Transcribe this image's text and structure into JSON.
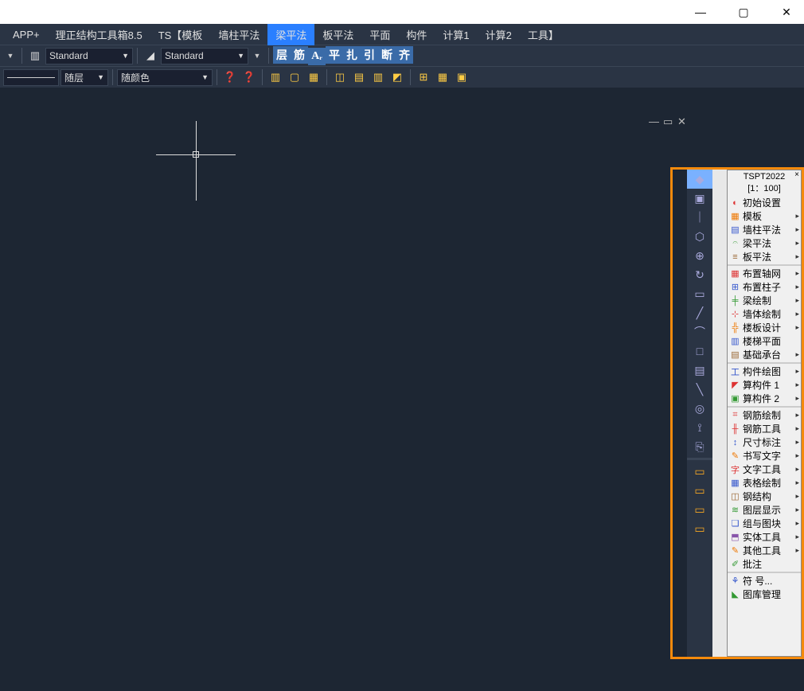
{
  "window": {
    "minimize": "—",
    "maximize": "▢",
    "close": "✕"
  },
  "menu": {
    "items": [
      "APP+",
      "理正结构工具箱8.5",
      "TS【模板",
      "墙柱平法",
      "梁平法",
      "板平法",
      "平面",
      "构件",
      "计算1",
      "计算2",
      "工具】"
    ],
    "activeIndex": 4
  },
  "toolbar1": {
    "style1": "Standard",
    "style2": "Standard",
    "rightIcons": [
      "层",
      "筋",
      "Aᵣ",
      "平",
      "扎",
      "引",
      "断",
      "齐"
    ]
  },
  "toolbar2": {
    "layer": "随层",
    "color": "随颜色"
  },
  "canvasCtrl": {
    "min": "—",
    "max": "▭",
    "close": "✕"
  },
  "rightPanel": {
    "title1": "TSPT2022",
    "title2": "[1：100]",
    "groups": [
      {
        "items": [
          {
            "label": "初始设置",
            "icon": "◐",
            "cls": "red",
            "arrow": false
          },
          {
            "label": "模板",
            "icon": "▦",
            "cls": "orange",
            "arrow": true
          },
          {
            "label": "墙柱平法",
            "icon": "▤",
            "cls": "blue",
            "arrow": true
          },
          {
            "label": "梁平法",
            "icon": "𝄐",
            "cls": "green",
            "arrow": true
          },
          {
            "label": "板平法",
            "icon": "≡",
            "cls": "brown",
            "arrow": true
          }
        ]
      },
      {
        "items": [
          {
            "label": "布置轴网",
            "icon": "▦",
            "cls": "red",
            "arrow": true
          },
          {
            "label": "布置柱子",
            "icon": "⊞",
            "cls": "blue",
            "arrow": true
          },
          {
            "label": "梁绘制",
            "icon": "╪",
            "cls": "green",
            "arrow": true
          },
          {
            "label": "墙体绘制",
            "icon": "⊹",
            "cls": "red",
            "arrow": true
          },
          {
            "label": "楼板设计",
            "icon": "╬",
            "cls": "orange",
            "arrow": true
          },
          {
            "label": "楼梯平面",
            "icon": "▥",
            "cls": "blue",
            "arrow": false
          },
          {
            "label": "基础承台",
            "icon": "▤",
            "cls": "brown",
            "arrow": true
          }
        ]
      },
      {
        "items": [
          {
            "label": "构件绘图",
            "icon": "工",
            "cls": "blue",
            "arrow": true
          },
          {
            "label": "算构件 1",
            "icon": "◤",
            "cls": "red",
            "arrow": true
          },
          {
            "label": "算构件 2",
            "icon": "▣",
            "cls": "green",
            "arrow": true
          }
        ]
      },
      {
        "items": [
          {
            "label": "钢筋绘制",
            "icon": "⌗",
            "cls": "red",
            "arrow": true
          },
          {
            "label": "钢筋工具",
            "icon": "╫",
            "cls": "red",
            "arrow": true
          },
          {
            "label": "尺寸标注",
            "icon": "↕",
            "cls": "blue",
            "arrow": true
          },
          {
            "label": "书写文字",
            "icon": "✎",
            "cls": "orange",
            "arrow": true
          },
          {
            "label": "文字工具",
            "icon": "字",
            "cls": "red",
            "arrow": true
          },
          {
            "label": "表格绘制",
            "icon": "▦",
            "cls": "blue",
            "arrow": true
          },
          {
            "label": "钢结构",
            "icon": "◫",
            "cls": "brown",
            "arrow": true
          },
          {
            "label": "图层显示",
            "icon": "≋",
            "cls": "green",
            "arrow": true
          },
          {
            "label": "组与图块",
            "icon": "❏",
            "cls": "blue",
            "arrow": true
          },
          {
            "label": "实体工具",
            "icon": "⬒",
            "cls": "purple",
            "arrow": true
          },
          {
            "label": "其他工具",
            "icon": "✎",
            "cls": "orange",
            "arrow": true
          },
          {
            "label": "批注",
            "icon": "✐",
            "cls": "green",
            "arrow": false
          }
        ]
      },
      {
        "items": [
          {
            "label": "符 号...",
            "icon": "⚘",
            "cls": "blue",
            "arrow": false
          },
          {
            "label": "图库管理",
            "icon": "◣",
            "cls": "green",
            "arrow": false
          }
        ]
      }
    ]
  },
  "vertToolbar": {
    "top": [
      "◆",
      "▣",
      "｜",
      "⬡",
      "⊕",
      "↻",
      "▭",
      "╱",
      "⌒",
      "□",
      "▤",
      "╲",
      "◎",
      "⟟",
      "⎘"
    ],
    "bottom": [
      "▭",
      "▭",
      "▭",
      "▭"
    ]
  }
}
